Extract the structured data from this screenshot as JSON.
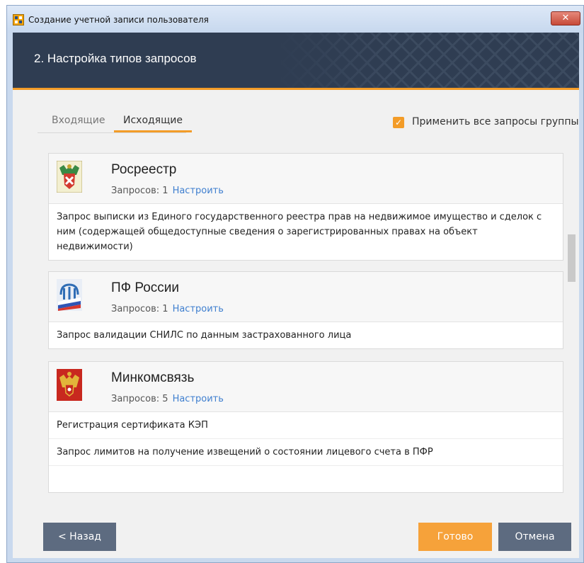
{
  "window": {
    "title": "Создание учетной записи пользователя",
    "close_icon": "close-icon"
  },
  "banner": {
    "title": "2. Настройка типов запросов"
  },
  "tabs": [
    {
      "label": "Входящие"
    },
    {
      "label": "Исходящие"
    }
  ],
  "apply_all": {
    "label": "Применить все запросы группы",
    "checked": true
  },
  "cards": [
    {
      "name": "Росреестр",
      "count_label": "Запросов: 1",
      "configure_label": "Настроить",
      "requests": [
        "Запрос выписки из Единого государственного реестра прав на недвижимое имущество и сделок с ним (содержащей общедоступные сведения о зарегистрированных правах на объект недвижимости)"
      ]
    },
    {
      "name": "ПФ России",
      "count_label": "Запросов: 1",
      "configure_label": "Настроить",
      "requests": [
        "Запрос валидации СНИЛС по данным застрахованного лица"
      ]
    },
    {
      "name": "Минкомсвязь",
      "count_label": "Запросов: 5",
      "configure_label": "Настроить",
      "requests": [
        "Регистрация сертификата КЭП",
        "Запрос лимитов на получение извещений о состоянии лицевого счета в ПФР"
      ]
    }
  ],
  "footer": {
    "back_label": "< Назад",
    "done_label": "Готово",
    "cancel_label": "Отмена"
  },
  "colors": {
    "accent": "#f39c28",
    "banner": "#2f3d52",
    "link": "#3f7fcf",
    "button": "#5d6b80"
  }
}
